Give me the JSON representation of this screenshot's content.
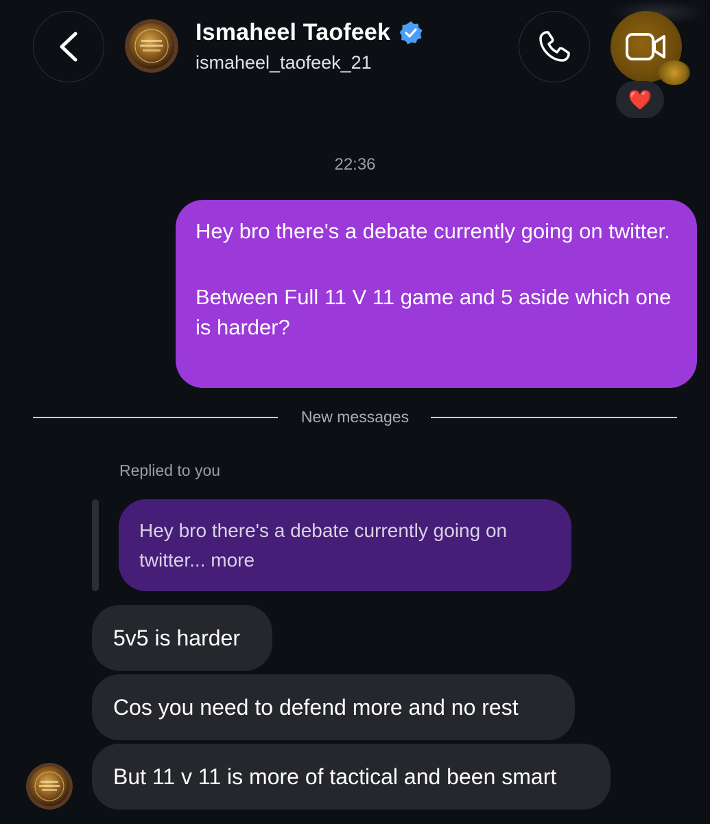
{
  "header": {
    "name": "Ismaheel Taofeek",
    "handle": "ismaheel_taofeek_21",
    "verified": true,
    "back_icon": "chevron-left-icon",
    "call_icon": "phone-icon",
    "video_icon": "video-camera-icon",
    "accent_color": "#4b9ef6"
  },
  "reaction": {
    "emoji": "❤️"
  },
  "conversation": {
    "timestamp": "22:36",
    "sent_message": {
      "paragraph1": "Hey bro there's a debate currently going on twitter.",
      "paragraph2": "Between Full 11 V 11 game and 5 aside which one is harder?",
      "color": "#9b3ad9"
    },
    "new_messages_label": "New messages",
    "reply": {
      "label": "Replied to you",
      "quoted_text": "Hey bro there's a debate currently going on twitter... more",
      "color": "#461e78"
    },
    "received_messages": [
      {
        "text": "5v5 is harder"
      },
      {
        "text": "Cos you need to defend more and no rest"
      },
      {
        "text": "But 11 v 11 is more of tactical and been smart"
      }
    ]
  }
}
